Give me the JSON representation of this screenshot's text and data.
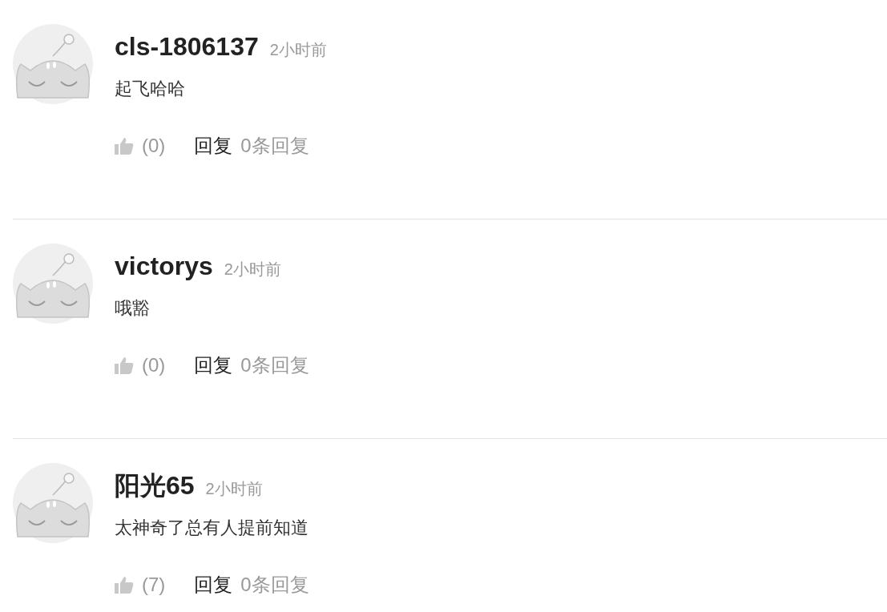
{
  "comments": [
    {
      "username": "cls-1806137",
      "time": "2小时前",
      "text": "起飞哈哈",
      "likes": "(0)",
      "reply_button": "回复",
      "reply_count": "0条回复"
    },
    {
      "username": "victorys",
      "time": "2小时前",
      "text": "哦豁",
      "likes": "(0)",
      "reply_button": "回复",
      "reply_count": "0条回复"
    },
    {
      "username": "阳光65",
      "time": "2小时前",
      "text": "太神奇了总有人提前知道",
      "likes": "(7)",
      "reply_button": "回复",
      "reply_count": "0条回复"
    }
  ]
}
